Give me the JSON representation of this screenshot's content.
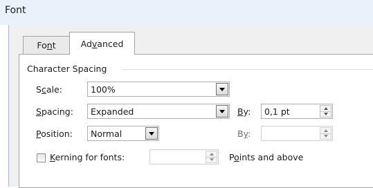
{
  "window": {
    "title": "Font"
  },
  "tabs": [
    {
      "label_pre": "Fo",
      "label_ul": "n",
      "label_post": "t",
      "active": false
    },
    {
      "label_pre": "Ad",
      "label_ul": "v",
      "label_post": "anced",
      "active": true
    }
  ],
  "group": {
    "label": "Character Spacing"
  },
  "scale": {
    "label_pre": "S",
    "label_ul": "c",
    "label_post": "ale:",
    "value": "100%"
  },
  "spacing": {
    "label_pre": "",
    "label_ul": "S",
    "label_post": "pacing:",
    "value": "Expanded",
    "by_label_pre": "",
    "by_label_ul": "B",
    "by_label_post": "y:",
    "by_value": "0,1 pt"
  },
  "position": {
    "label_pre": "",
    "label_ul": "P",
    "label_post": "osition:",
    "value": "Normal",
    "by_label_pre": "B",
    "by_label_ul": "y",
    "by_label_post": ":",
    "by_value": ""
  },
  "kerning": {
    "checked": false,
    "label_pre": "",
    "label_ul": "K",
    "label_post": "erning for fonts:",
    "value": "",
    "suffix_pre": "P",
    "suffix_ul": "o",
    "suffix_post": "ints and above"
  }
}
